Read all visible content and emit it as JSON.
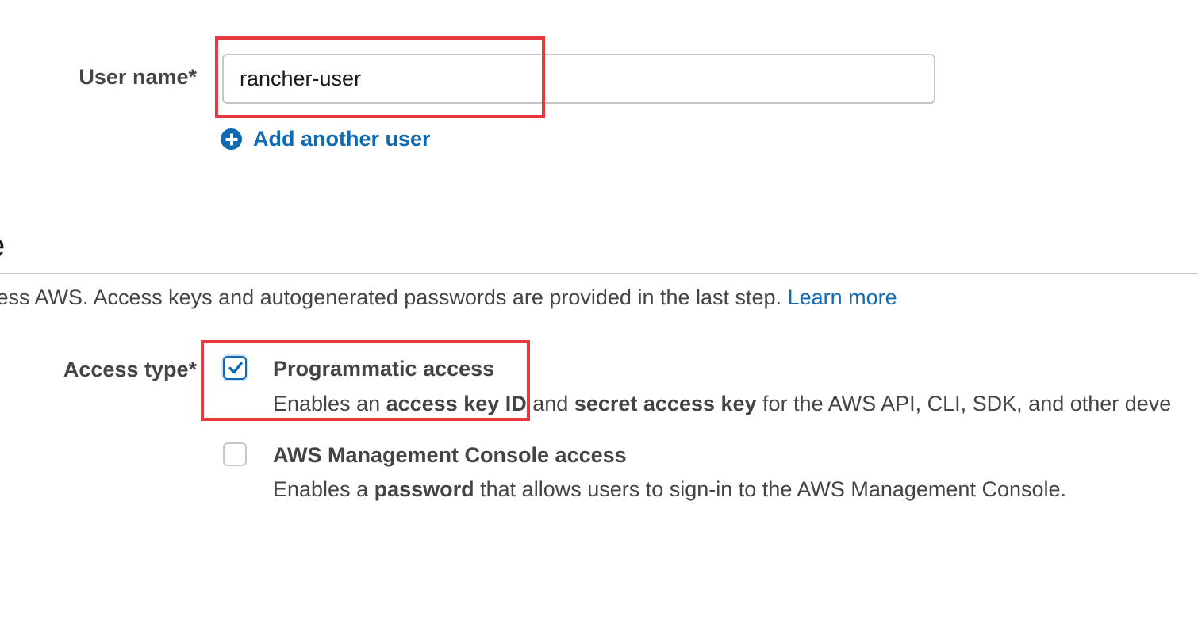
{
  "form": {
    "user_name_label": "User name*",
    "user_name_value": "rancher-user",
    "add_user_label": "Add another user"
  },
  "access_section": {
    "title_fragment": "e",
    "description_text": "cess AWS. Access keys and autogenerated passwords are provided in the last step. ",
    "learn_more_label": "Learn more",
    "access_type_label": "Access type*",
    "options": [
      {
        "title": "Programmatic access",
        "checked": true,
        "desc_parts": [
          "Enables an ",
          "access key ID",
          " and ",
          "secret access key",
          " for the AWS API, CLI, SDK, and other deve"
        ]
      },
      {
        "title": "AWS Management Console access",
        "checked": false,
        "desc_parts": [
          "Enables a ",
          "password",
          " that allows users to sign-in to the AWS Management Console."
        ]
      }
    ]
  },
  "colors": {
    "link_blue": "#0f6ab4",
    "highlight_red": "#e8383d",
    "label_gray": "#444444",
    "border_gray": "#c6c6c6"
  }
}
